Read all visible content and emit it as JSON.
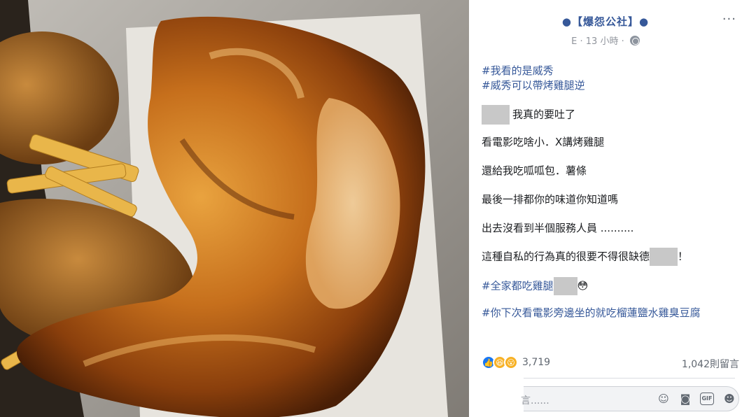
{
  "post": {
    "page_name": "●【爆怨公社】●",
    "more_label": "···",
    "meta_prefix": "E",
    "timestamp": "13 小時",
    "meta_sep": "·",
    "hashtag_1": "#我看的是威秀",
    "hashtag_2": "#威秀可以帶烤雞腿逆",
    "line_1": "我真的要吐了",
    "line_2": "看電影吃啥小．X講烤雞腿",
    "line_3": "還給我吃呱呱包．薯條",
    "line_4": "最後一排都你的味道你知道嗎",
    "line_5": "出去沒看到半個服務人員 ..........",
    "line_6_a": "這種自私的行為真的很要不得很缺德",
    "line_6_b": "！",
    "hashtag_3": "#全家都吃雞腿",
    "emoji_3": "😳",
    "hashtag_4": "#你下次看電影旁邊坐的就吃榴蓮鹽水雞臭豆腐",
    "reaction_count": "3,719",
    "comment_count": "1,042則留言",
    "comment_placeholder": "言......"
  },
  "icons": {
    "like": "like-icon",
    "haha": "haha-icon",
    "wow": "wow-icon",
    "emoji": "emoji-icon",
    "camera": "camera-icon",
    "gif": "gif-icon",
    "sticker": "sticker-icon"
  },
  "colors": {
    "link": "#365899",
    "like": "#1877f2",
    "reaction_yellow": "#f7b125"
  }
}
